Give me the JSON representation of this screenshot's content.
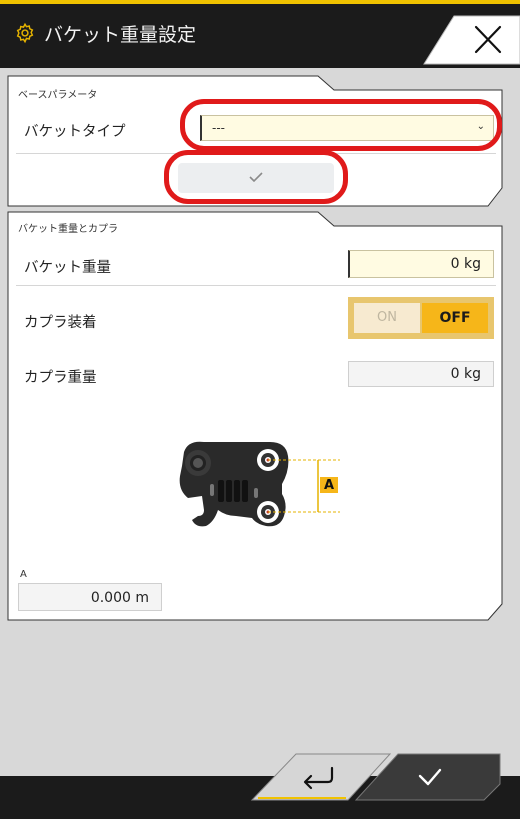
{
  "header": {
    "title": "バケット重量設定",
    "gear_icon": "gear-icon",
    "close_icon": "close-icon"
  },
  "base_params": {
    "section_label": "ベースパラメータ",
    "bucket_type_label": "バケットタイプ",
    "bucket_type_value": "---",
    "apply_icon": "check-icon"
  },
  "bucket_coupler": {
    "section_label": "バケット重量とカプラ",
    "bucket_weight_label": "バケット重量",
    "bucket_weight_value": "0 kg",
    "coupler_label": "カプラ装着",
    "toggle_on": "ON",
    "toggle_off": "OFF",
    "toggle_selected": "OFF",
    "coupler_weight_label": "カプラ重量",
    "coupler_weight_value": "0 kg",
    "diagram_marker": "A",
    "a_label": "A",
    "a_value": "0.000 m"
  },
  "footer": {
    "back_icon": "return-icon",
    "confirm_icon": "check-icon"
  },
  "colors": {
    "accent_yellow": "#f0c200",
    "toggle_active": "#f6b619",
    "highlight_ring": "#e01a1a",
    "topbar": "#1b1b1b"
  }
}
